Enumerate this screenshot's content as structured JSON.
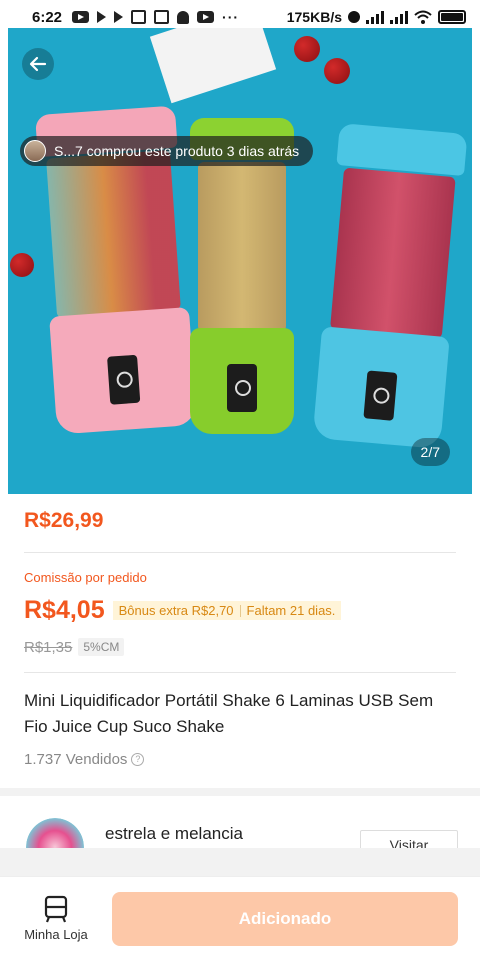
{
  "status_bar": {
    "time": "6:22",
    "speed": "175KB/s"
  },
  "product": {
    "toast": "S...7 comprou este produto 3 dias atrás",
    "image_counter": "2/7",
    "price": "R$26,99",
    "commission_label": "Comissão por pedido",
    "commission_value": "R$4,05",
    "bonus_text": "Bônus extra R$2,70",
    "days_left": "Faltam 21 dias.",
    "old_commission": "R$1,35",
    "commission_pct": "5%CM",
    "title": "Mini Liquidificador Portátil Shake 6 Laminas USB Sem Fio Juice Cup Suco Shake",
    "sold": "1.737 Vendidos"
  },
  "store": {
    "name": "estrela e melancia",
    "visit_label": "Visitar"
  },
  "bottom_bar": {
    "my_store_label": "Minha Loja",
    "add_label": "Adicionado"
  },
  "colors": {
    "accent": "#f2571e",
    "button_disabled": "#fdc8a8",
    "hero_bg": "#1fa7c9"
  }
}
